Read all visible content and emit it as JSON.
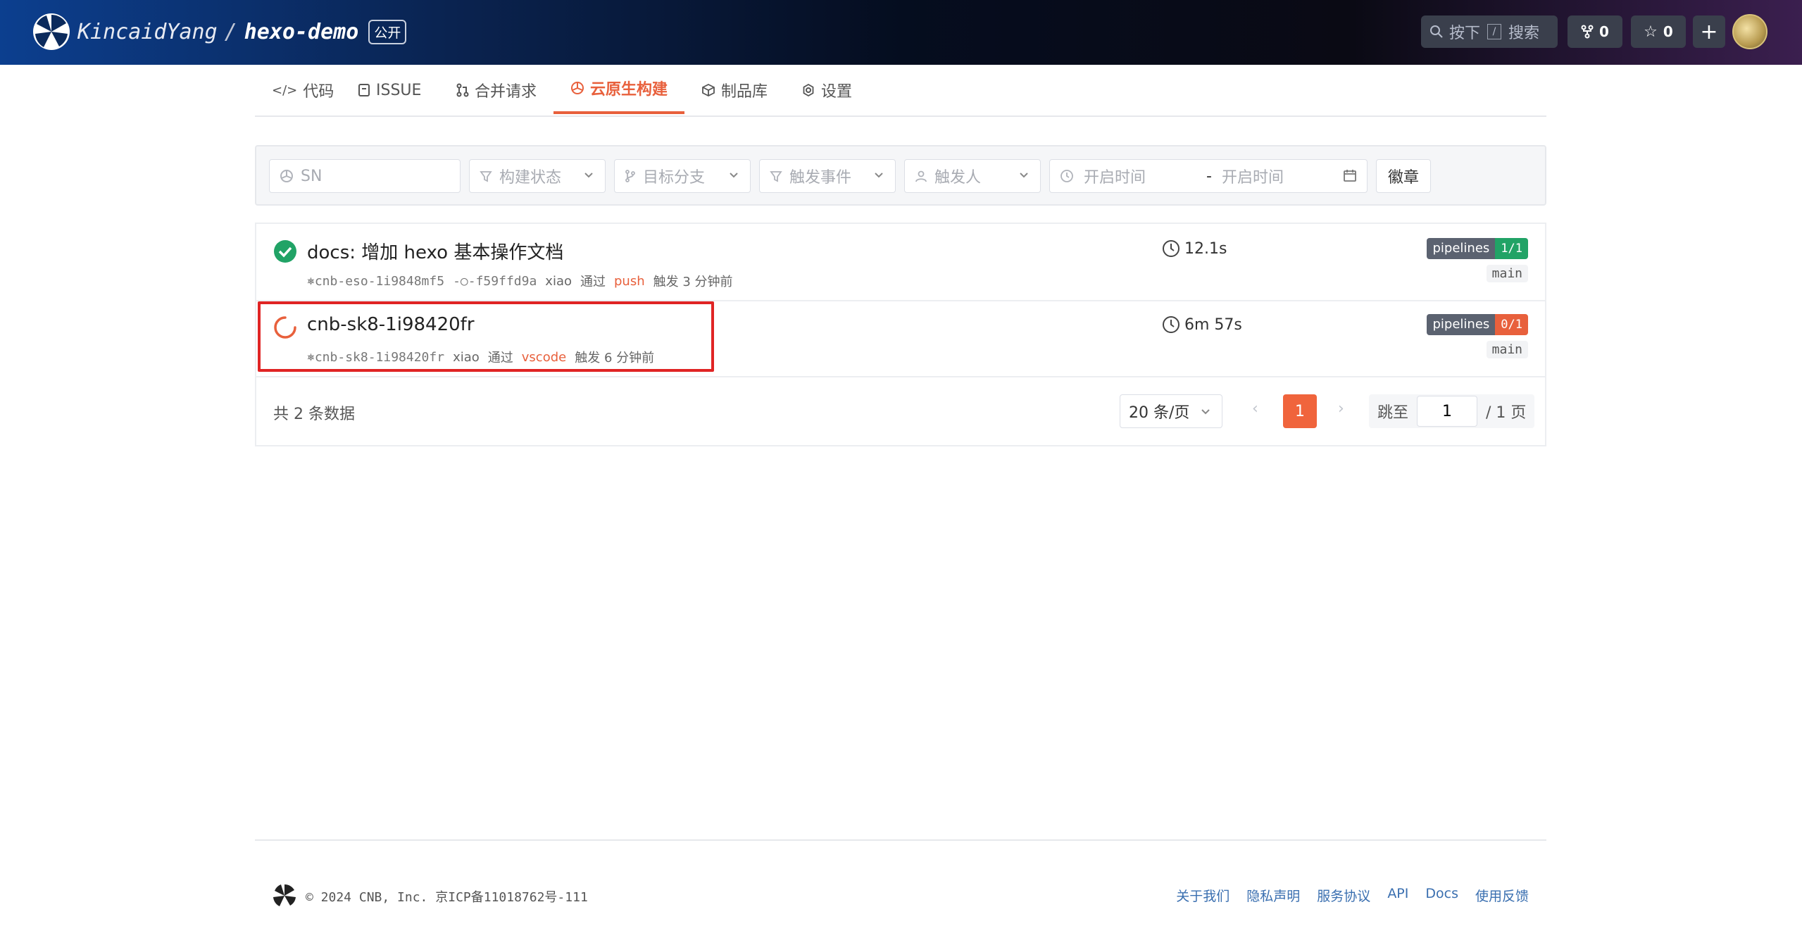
{
  "header": {
    "owner": "KincaidYang",
    "separator": "/",
    "repo": "hexo-demo",
    "visibility": "公开",
    "search_prefix": "按下",
    "search_key": "/",
    "search_label": "搜索",
    "fork_count": "0",
    "star_count": "0",
    "add_label": "+"
  },
  "tabs": [
    {
      "label": "代码",
      "icon": "code-icon"
    },
    {
      "label": "ISSUE",
      "icon": "issue-icon"
    },
    {
      "label": "合并请求",
      "icon": "merge-icon"
    },
    {
      "label": "云原生构建",
      "icon": "build-icon",
      "active": true
    },
    {
      "label": "制品库",
      "icon": "package-icon"
    },
    {
      "label": "设置",
      "icon": "gear-icon"
    }
  ],
  "filters": {
    "sn_placeholder": "SN",
    "status_placeholder": "构建状态",
    "branch_placeholder": "目标分支",
    "event_placeholder": "触发事件",
    "trigger_user_placeholder": "触发人",
    "start_time_placeholder": "开启时间",
    "range_sep": "-",
    "end_time_placeholder": "开启时间",
    "badge_button": "徽章"
  },
  "builds": [
    {
      "status": "success",
      "title": "docs: 增加 hexo 基本操作文档",
      "sn": "cnb-eso-1i9848mf5",
      "commit": "f59ffd9a",
      "user": "xiao",
      "via": "通过",
      "event": "push",
      "trigger_text": "触发 3 分钟前",
      "duration": "12.1s",
      "pipeline_label": "pipelines",
      "pipeline_count": "1/1",
      "branch": "main"
    },
    {
      "status": "running",
      "title": "cnb-sk8-1i98420fr",
      "sn": "cnb-sk8-1i98420fr",
      "user": "xiao",
      "via": "通过",
      "event": "vscode",
      "trigger_text": "触发 6 分钟前",
      "duration": "6m 57s",
      "pipeline_label": "pipelines",
      "pipeline_count": "0/1",
      "branch": "main"
    }
  ],
  "pagination": {
    "total": "共 2 条数据",
    "page_size": "20 条/页",
    "current": "1",
    "jump_label": "跳至",
    "jump_value": "1",
    "pages_suffix": "/ 1 页"
  },
  "footer": {
    "copyright": "© 2024 CNB, Inc.  京ICP备11018762号-111",
    "links": [
      "关于我们",
      "隐私声明",
      "服务协议",
      "API",
      "Docs",
      "使用反馈"
    ]
  },
  "colors": {
    "accent": "#e8603c",
    "success": "#21a366",
    "highlight_border": "#e02424"
  }
}
